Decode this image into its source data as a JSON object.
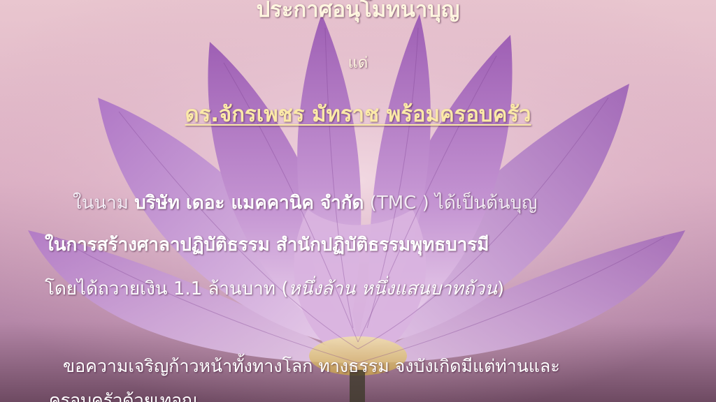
{
  "announcement": {
    "heading": "ประกาศอนุโมทนาบุญ",
    "to": "แด่",
    "recipient": "ดร.จักรเพชร มัทราช พร้อมครอบครัว"
  },
  "body": {
    "line1": {
      "prefix": "ในนาม ",
      "company": "บริษัท เดอะ แมคคานิค จำกัด",
      "suffix": " (TMC ) ได้เป็นต้นบุญ"
    },
    "line2": "ในการสร้างศาลาปฏิบัติธรรม สำนักปฏิบัติธรรมพุทธบารมี",
    "line3": {
      "prefix": "โดยได้ถวายเงิน 1.1 ล้านบาท  (",
      "amount_words": "หนึ่งล้าน หนึ่งแสนบาทถ้วน",
      "suffix": ")"
    },
    "line4": "ขอความเจริญก้าวหน้าทั้งทางโลก ทางธรรม จงบังเกิดมีแต่ท่านและ",
    "line5": "ครอบครัวด้วยเทอญ"
  },
  "colors": {
    "background": "#e3bccb",
    "petal": "#b77fc4",
    "text": "#ffffff",
    "recipient": "#fbe9a8"
  }
}
